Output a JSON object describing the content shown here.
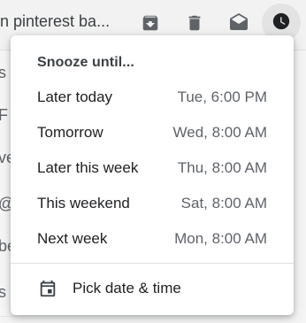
{
  "email_row": {
    "subject": "n pinterest ba..."
  },
  "left_rows": [
    {
      "text": "s ("
    },
    {
      "text": "F"
    },
    {
      "text": "ve"
    },
    {
      "text": "@"
    },
    {
      "text": "be"
    },
    {
      "text": "s T"
    }
  ],
  "icons": {
    "archive": "archive-icon",
    "delete": "trash-icon",
    "mark_read": "mark-read-icon",
    "snooze": "clock-icon",
    "calendar": "calendar-icon"
  },
  "snooze_menu": {
    "title": "Snooze until...",
    "items": [
      {
        "label": "Later today",
        "when": "Tue, 6:00 PM"
      },
      {
        "label": "Tomorrow",
        "when": "Wed, 8:00 AM"
      },
      {
        "label": "Later this week",
        "when": "Thu, 8:00 AM"
      },
      {
        "label": "This weekend",
        "when": "Sat, 8:00 AM"
      },
      {
        "label": "Next week",
        "when": "Mon, 8:00 AM"
      }
    ],
    "pick_label": "Pick date & time"
  },
  "colors": {
    "icon": "#5f6368",
    "active_icon": "#202124",
    "menu_bg": "#ffffff"
  }
}
